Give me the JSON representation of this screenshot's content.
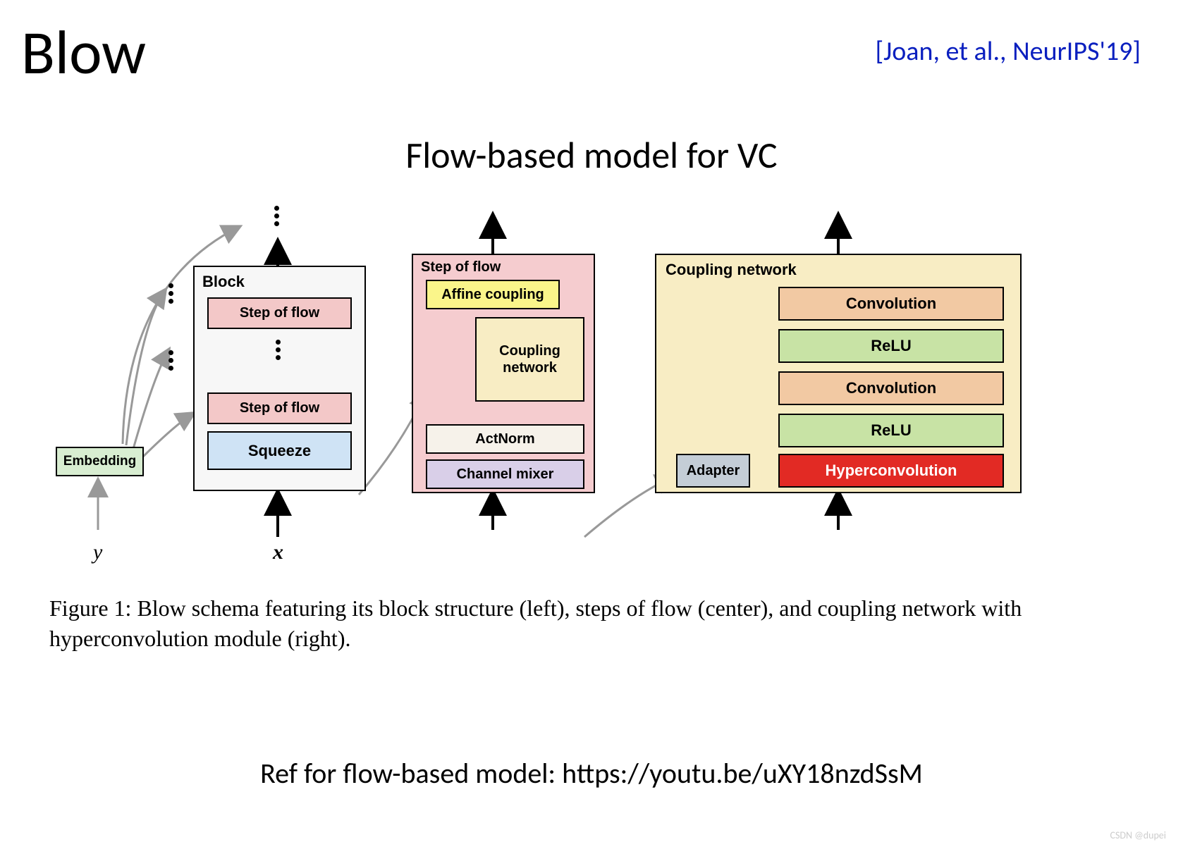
{
  "header": {
    "title": "Blow",
    "citation": "[Joan, et al., NeurIPS'19]"
  },
  "subtitle": "Flow-based model for VC",
  "diagram": {
    "embedding": "Embedding",
    "block": {
      "title": "Block",
      "step1": "Step of flow",
      "step2": "Step of flow",
      "squeeze": "Squeeze"
    },
    "step_of_flow": {
      "title": "Step of flow",
      "affine": "Affine coupling",
      "coupling": "Coupling network",
      "actnorm": "ActNorm",
      "mixer": "Channel mixer"
    },
    "coupling_network": {
      "title": "Coupling network",
      "conv1": "Convolution",
      "relu1": "ReLU",
      "conv2": "Convolution",
      "relu2": "ReLU",
      "hyper": "Hyperconvolution",
      "adapter": "Adapter"
    },
    "labels": {
      "y": "y",
      "x": "x"
    }
  },
  "caption": "Figure 1: Blow schema featuring its block structure (left), steps of flow (center), and coupling network with hyperconvolution module (right).",
  "reference": "Ref for flow-based model: https://youtu.be/uXY18nzdSsM",
  "watermark": "CSDN @dupei"
}
